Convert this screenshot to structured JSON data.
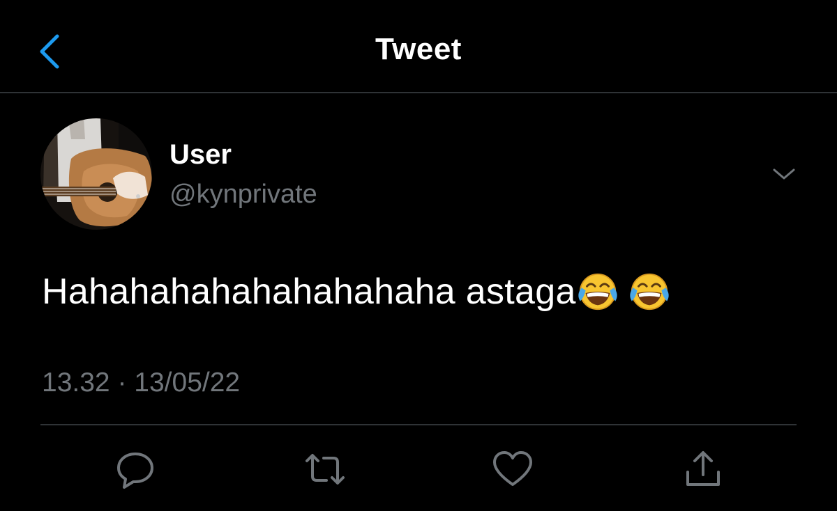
{
  "header": {
    "title": "Tweet",
    "back_icon": "chevron-left-icon"
  },
  "tweet": {
    "author": {
      "display_name": "User",
      "handle": "@kynprivate",
      "avatar_description": "person-with-guitar-avatar"
    },
    "text": "Hahahahahahahahahaha astaga",
    "emojis": [
      "face-with-tears-of-joy",
      "face-with-tears-of-joy"
    ],
    "time": "13.32",
    "separator": "·",
    "date": "13/05/22"
  },
  "actions": [
    "reply-icon",
    "retweet-icon",
    "like-icon",
    "share-icon"
  ],
  "colors": {
    "background": "#000000",
    "accent": "#1d9bf0",
    "text": "#ffffff",
    "secondary_text": "#71767b",
    "divider": "#2f3336"
  }
}
